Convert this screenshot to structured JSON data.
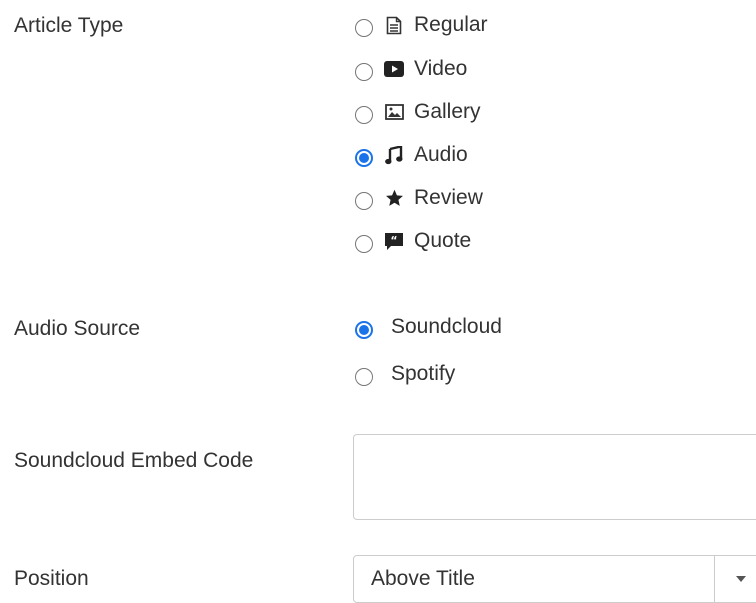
{
  "article_type": {
    "label": "Article Type",
    "options": [
      {
        "label": "Regular",
        "icon": "document-icon",
        "checked": false
      },
      {
        "label": "Video",
        "icon": "video-icon",
        "checked": false
      },
      {
        "label": "Gallery",
        "icon": "image-icon",
        "checked": false
      },
      {
        "label": "Audio",
        "icon": "music-icon",
        "checked": true
      },
      {
        "label": "Review",
        "icon": "star-icon",
        "checked": false
      },
      {
        "label": "Quote",
        "icon": "quote-icon",
        "checked": false
      }
    ]
  },
  "audio_source": {
    "label": "Audio Source",
    "options": [
      {
        "label": "Soundcloud",
        "checked": true
      },
      {
        "label": "Spotify",
        "checked": false
      }
    ]
  },
  "embed_code": {
    "label": "Soundcloud Embed Code",
    "value": ""
  },
  "position": {
    "label": "Position",
    "selected": "Above Title"
  },
  "colors": {
    "accent": "#1a73e8",
    "text": "#333333",
    "border": "#cccccc"
  }
}
